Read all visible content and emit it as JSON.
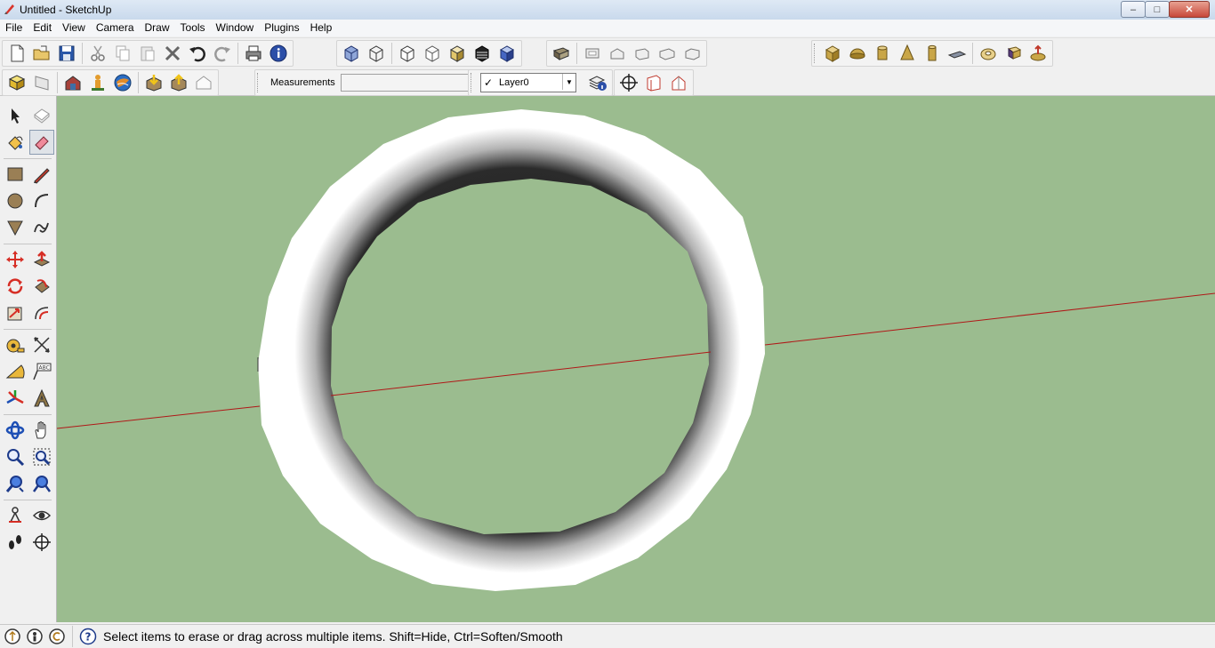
{
  "window": {
    "title": "Untitled - SketchUp",
    "buttons": {
      "minimize": "–",
      "maximize": "□",
      "close": "✕"
    }
  },
  "menu": [
    "File",
    "Edit",
    "View",
    "Camera",
    "Draw",
    "Tools",
    "Window",
    "Plugins",
    "Help"
  ],
  "toolbar": {
    "measurements_label": "Measurements",
    "measurements_value": "",
    "layer_selected": "Layer0",
    "layer_checked": "✓"
  },
  "status": {
    "help_icon": "?",
    "text": "Select items to erase or drag across multiple items. Shift=Hide, Ctrl=Soften/Smooth"
  },
  "colors": {
    "viewport_background": "#9bbc8f",
    "red_axis": "#b01818",
    "torus_face": "#ffffff"
  }
}
